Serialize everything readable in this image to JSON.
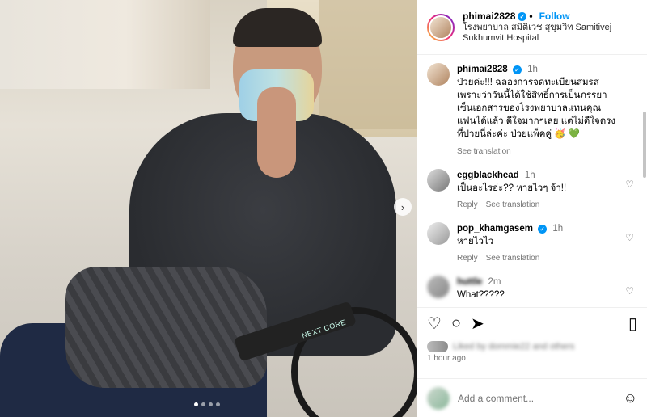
{
  "header": {
    "username": "phimai2828",
    "follow_label": "Follow",
    "location": "โรงพยาบาล สมิติเวช สุขุมวิท Samitivej Sukhumvit Hospital"
  },
  "caption": {
    "username": "phimai2828",
    "time": "1h",
    "text": "ป่วยค่ะ!!! ฉลองการจดทะเบียนสมรส เพราะว่าวันนี้ได้ใช้สิทธิ์การเป็นภรรยาเซ็นเอกสารของโรงพยาบาลแทนคุณแฟนได้แล้ว ดีใจมากๆเลย แต่ไม่ดีใจตรงที่ป่วยนี่ล่ะค่ะ ป่วยแพ็คคู่ 🥳 💚",
    "see_translation": "See translation"
  },
  "comments": [
    {
      "username": "eggblackhead",
      "time": "1h",
      "text": "เป็นอะไรอ่ะ?? หายไวๆ จ้า!!",
      "reply": "Reply",
      "translate": "See translation"
    },
    {
      "username": "pop_khamgasem",
      "time": "1h",
      "text": "หายไวไว",
      "reply": "Reply",
      "translate": "See translation",
      "verified": true
    },
    {
      "username": "huttle",
      "time": "2m",
      "text": "What?????"
    }
  ],
  "likes_text": "Liked by dommie22 and others",
  "posted_time": "1 hour ago",
  "add_comment_placeholder": "Add a comment...",
  "media": {
    "brand_tag": "NEXT CORE"
  },
  "icons": {
    "heart": "heart-icon",
    "comment": "comment-icon",
    "share": "share-icon",
    "bookmark": "bookmark-icon",
    "emoji": "emoji-icon",
    "next": "chevron-right-icon"
  },
  "colors": {
    "accent": "#0095f6",
    "border": "#efefef",
    "muted": "#737373"
  }
}
